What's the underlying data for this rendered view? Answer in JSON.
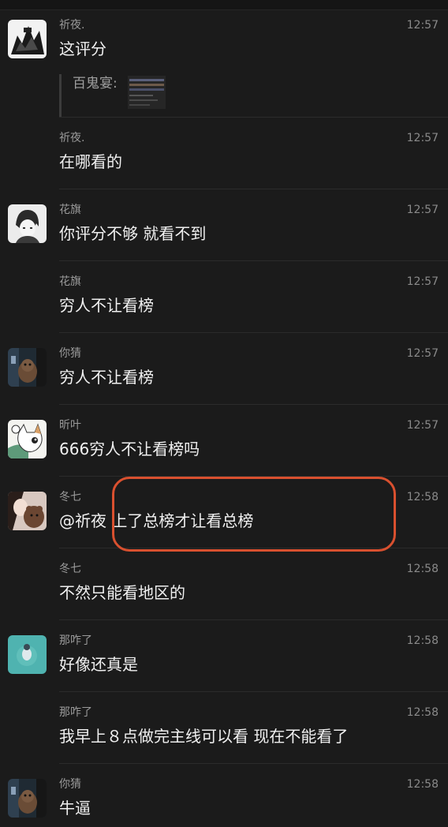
{
  "messages": [
    {
      "name": "祈夜.",
      "time": "12:57",
      "text": "这评分",
      "quote": "百鬼宴:"
    },
    {
      "name": "祈夜.",
      "time": "12:57",
      "text": "在哪看的"
    },
    {
      "name": "花旗",
      "time": "12:57",
      "text": "你评分不够 就看不到"
    },
    {
      "name": "花旗",
      "time": "12:57",
      "text": "穷人不让看榜"
    },
    {
      "name": "你猜",
      "time": "12:57",
      "text": "穷人不让看榜"
    },
    {
      "name": "昕叶",
      "time": "12:57",
      "text": "666穷人不让看榜吗"
    },
    {
      "name": "冬七",
      "time": "12:58",
      "text": "@祈夜  上了总榜才让看总榜"
    },
    {
      "name": "冬七",
      "time": "12:58",
      "text": "不然只能看地区的"
    },
    {
      "name": "那咋了",
      "time": "12:58",
      "text": "好像还真是"
    },
    {
      "name": "那咋了",
      "time": "12:58",
      "text": "我早上８点做完主线可以看 现在不能看了"
    },
    {
      "name": "你猜",
      "time": "12:58",
      "text": "牛逼"
    }
  ],
  "colors": {
    "background": "#1b1b1b",
    "highlight": "#d9502f"
  }
}
